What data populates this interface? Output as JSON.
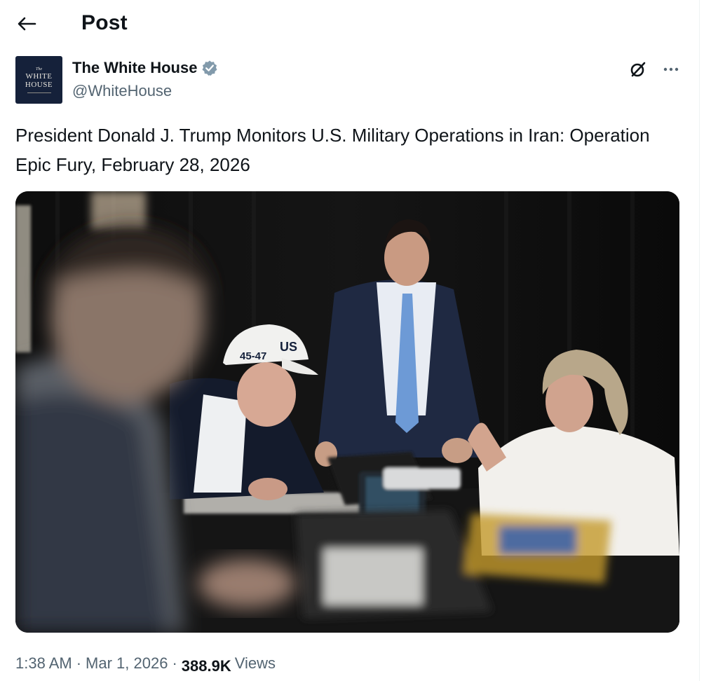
{
  "header": {
    "title": "Post"
  },
  "author": {
    "name": "The White House",
    "handle": "@WhiteHouse",
    "verified": true,
    "avatar_text": {
      "small": "The",
      "line1": "WHITE",
      "line2": "HOUSE"
    }
  },
  "post": {
    "text": "President Donald J. Trump Monitors U.S. Military Operations in Iran: Operation Epic Fury, February 28, 2026",
    "media": {
      "type": "photo",
      "cap_text_left": "45-47",
      "cap_text_right": "US"
    }
  },
  "meta": {
    "time": "1:38 AM",
    "date": "Mar 1, 2026",
    "views_count": "388.9K",
    "views_label": "Views"
  },
  "icons": {
    "back": "back-arrow-icon",
    "verified": "verified-badge-icon",
    "grok": "grok-icon",
    "more": "more-options-icon"
  },
  "colors": {
    "text_primary": "#0f1419",
    "text_secondary": "#536471",
    "verified_badge": "#829aab",
    "avatar_bg": "#15213a"
  }
}
